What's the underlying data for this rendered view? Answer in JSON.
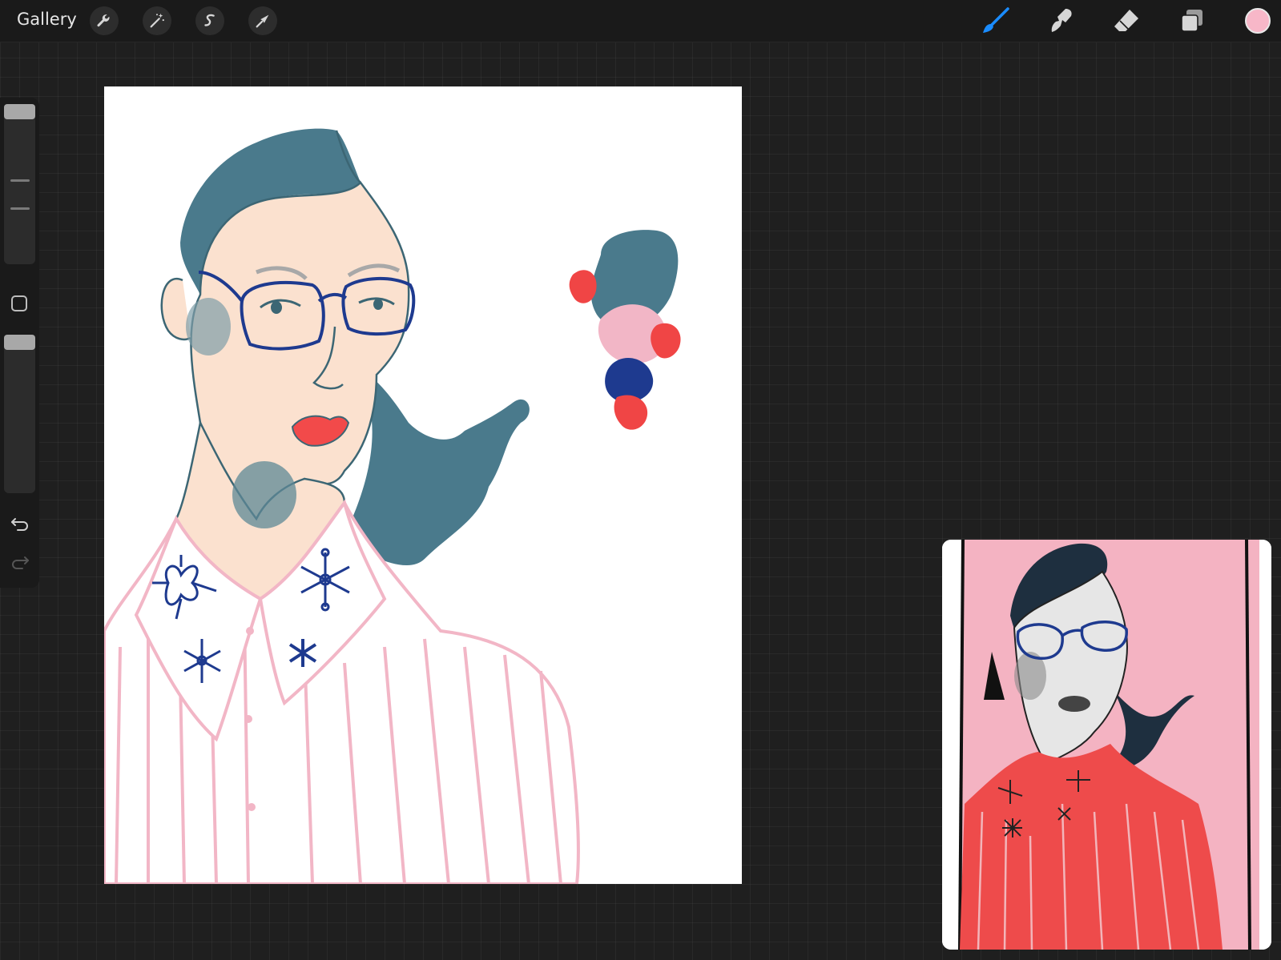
{
  "app": {
    "gallery_label": "Gallery"
  },
  "toolbar": {
    "left_icons": [
      "wrench-icon",
      "magic-wand-icon",
      "selection-s-icon",
      "transform-arrow-icon"
    ],
    "right_tools": [
      "brush-icon",
      "smudge-icon",
      "eraser-icon",
      "layers-icon"
    ],
    "active_tool": "brush",
    "active_tool_color": "#1a8cff",
    "current_color": "#f7b7c8"
  },
  "sidebar": {
    "size_slider_level": 0.0,
    "opacity_slider_level": 0.0,
    "icons": [
      "modifier-square-icon",
      "undo-icon",
      "redo-icon"
    ]
  },
  "canvas": {
    "background": "#ffffff",
    "palette_swatches": [
      "#4a7a8c",
      "#f04545",
      "#f2b6c6",
      "#1e3a8f"
    ]
  },
  "reference_window": {
    "background": "#f4b3c2",
    "shirt_color": "#ee4b4b"
  }
}
